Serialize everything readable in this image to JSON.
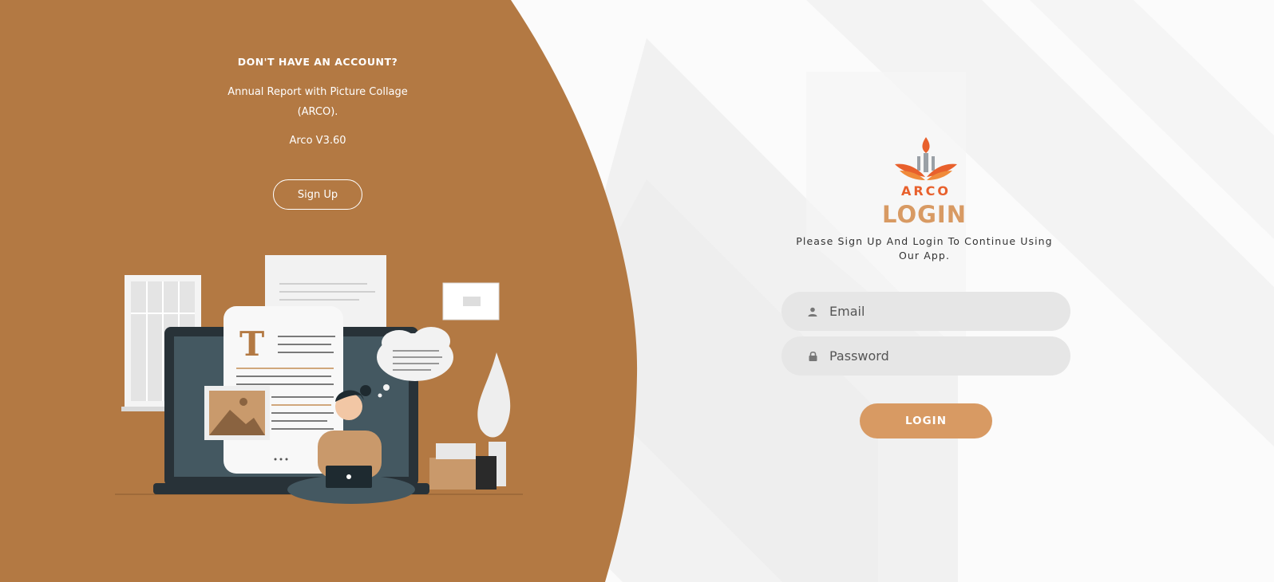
{
  "colors": {
    "panel_brown": "#b37943",
    "accent": "#d89a63",
    "logo_orange": "#e8602c",
    "field_bg": "#e6e6e6"
  },
  "left": {
    "heading": "DON'T HAVE AN ACCOUNT?",
    "description": "Annual Report with Picture Collage (ARCO).",
    "version": "Arco V3.60",
    "signup_label": "Sign Up"
  },
  "logo": {
    "text": "ARCO",
    "icon": "torch-book-logo"
  },
  "login": {
    "title": "LOGIN",
    "subtitle": "Please Sign Up And Login To Continue Using Our App.",
    "email_placeholder": "Email",
    "password_placeholder": "Password",
    "email_icon": "user-icon",
    "password_icon": "lock-icon",
    "button_label": "LOGIN"
  }
}
